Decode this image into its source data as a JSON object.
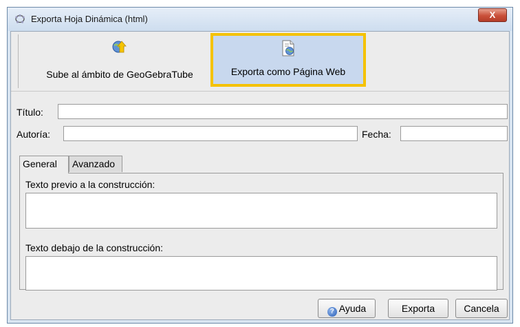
{
  "window": {
    "title": "Exporta Hoja Dinámica (html)",
    "close_glyph": "X"
  },
  "toolbar": {
    "upload_label": "Sube al ámbito de GeoGebraTube",
    "upload_icon": "globe-upload-icon",
    "export_web_label": "Exporta como Página Web",
    "export_web_icon": "webpage-icon",
    "selected": "export_web",
    "highlight_color": "#f5c200"
  },
  "form": {
    "title_label": "Título:",
    "title_value": "",
    "author_label": "Autoría:",
    "author_value": "",
    "date_label": "Fecha:",
    "date_value": ""
  },
  "tabs": {
    "general": "General",
    "advanced": "Avanzado",
    "active": "general"
  },
  "general_tab": {
    "text_before_label": "Texto previo a la construcción:",
    "text_before_value": "",
    "text_after_label": "Texto debajo de la construcción:",
    "text_after_value": ""
  },
  "buttons": {
    "help": "Ayuda",
    "help_icon": "help-icon",
    "export": "Exporta",
    "cancel": "Cancela"
  }
}
